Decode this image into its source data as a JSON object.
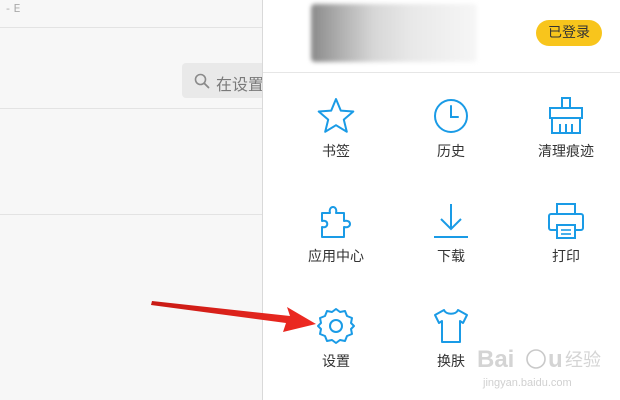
{
  "background": {
    "tab_hint": "- E",
    "search_placeholder": "在设置"
  },
  "panel": {
    "login_badge": "已登录",
    "items": [
      {
        "label": "书签",
        "icon": "star-icon"
      },
      {
        "label": "历史",
        "icon": "clock-icon"
      },
      {
        "label": "清理痕迹",
        "icon": "broom-icon"
      },
      {
        "label": "应用中心",
        "icon": "puzzle-icon"
      },
      {
        "label": "下载",
        "icon": "download-icon"
      },
      {
        "label": "打印",
        "icon": "printer-icon"
      },
      {
        "label": "设置",
        "icon": "gear-icon"
      },
      {
        "label": "换肤",
        "icon": "shirt-icon"
      }
    ]
  },
  "watermark": {
    "brand": "Baidu经验",
    "url": "jingyan.baidu.com"
  },
  "colors": {
    "icon_blue": "#1a9be6",
    "badge_yellow": "#f8c51c",
    "arrow_red": "#e0201a"
  }
}
